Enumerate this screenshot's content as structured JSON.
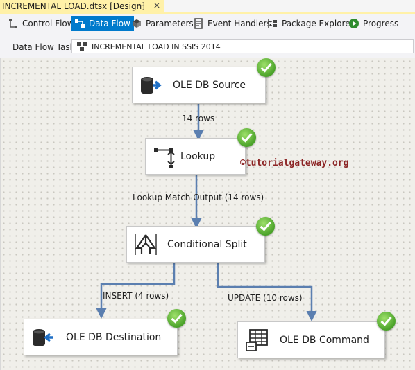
{
  "document_tab": {
    "title": "INCREMENTAL LOAD.dtsx [Design]",
    "pin_glyph": "⊣",
    "close_glyph": "×"
  },
  "toolbar": {
    "tabs": [
      {
        "label": "Control Flow",
        "icon": "control-flow-icon"
      },
      {
        "label": "Data Flow",
        "icon": "data-flow-icon",
        "active": true
      },
      {
        "label": "Parameters",
        "icon": "parameters-icon"
      },
      {
        "label": "Event Handlers",
        "icon": "event-handlers-icon"
      },
      {
        "label": "Package Explorer",
        "icon": "package-explorer-icon"
      },
      {
        "label": "Progress",
        "icon": "progress-icon"
      }
    ]
  },
  "task_bar": {
    "label": "Data Flow Task:",
    "selected_task": "INCREMENTAL LOAD IN SSIS 2014"
  },
  "canvas": {
    "watermark": "©tutorialgateway.org",
    "components": [
      {
        "label": "OLE DB Source",
        "icon": "ole-db-source-icon",
        "status": "success"
      },
      {
        "label": "Lookup",
        "icon": "lookup-icon",
        "status": "success"
      },
      {
        "label": "Conditional Split",
        "icon": "conditional-split-icon",
        "status": "success"
      },
      {
        "label": "OLE DB Destination",
        "icon": "ole-db-destination-icon",
        "status": "success"
      },
      {
        "label": "OLE DB Command",
        "icon": "ole-db-command-icon",
        "status": "success"
      }
    ],
    "paths": [
      {
        "label": "14 rows"
      },
      {
        "label": "Lookup Match Output (14 rows)"
      },
      {
        "label": "INSERT (4 rows)"
      },
      {
        "label": "UPDATE (10 rows)"
      }
    ]
  },
  "colors": {
    "accent": "#007acc",
    "tab_highlight": "#fff1a8",
    "path_arrow": "#5b7fb0",
    "success": "#4aa229",
    "watermark": "#8b2323"
  }
}
